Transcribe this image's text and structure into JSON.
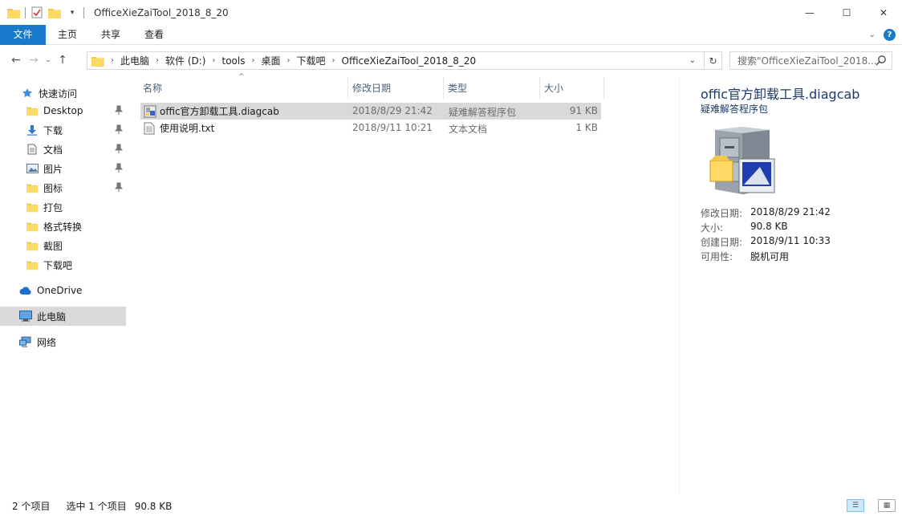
{
  "window": {
    "title": "OfficeXieZaiTool_2018_8_20",
    "minimize": "—",
    "maximize": "☐",
    "close": "✕"
  },
  "ribbon": {
    "tabs": [
      "文件",
      "主页",
      "共享",
      "查看"
    ]
  },
  "address": {
    "crumbs": [
      "此电脑",
      "软件 (D:)",
      "tools",
      "桌面",
      "下载吧",
      "OfficeXieZaiTool_2018_8_20"
    ]
  },
  "search": {
    "placeholder": "搜索\"OfficeXieZaiTool_2018..."
  },
  "sidebar": {
    "quick_access": "快速访问",
    "items": [
      {
        "label": "Desktop",
        "pinned": true
      },
      {
        "label": "下载",
        "pinned": true
      },
      {
        "label": "文档",
        "pinned": true
      },
      {
        "label": "图片",
        "pinned": true
      },
      {
        "label": "图标",
        "pinned": true
      },
      {
        "label": "打包",
        "pinned": false
      },
      {
        "label": "格式转换",
        "pinned": false
      },
      {
        "label": "截图",
        "pinned": false
      },
      {
        "label": "下载吧",
        "pinned": false
      }
    ],
    "onedrive": "OneDrive",
    "this_pc": "此电脑",
    "network": "网络"
  },
  "columns": {
    "name": "名称",
    "modified": "修改日期",
    "type": "类型",
    "size": "大小"
  },
  "files": [
    {
      "name": "offic官方卸载工具.diagcab",
      "modified": "2018/8/29 21:42",
      "type": "疑难解答程序包",
      "size": "91 KB",
      "selected": true
    },
    {
      "name": "使用说明.txt",
      "modified": "2018/9/11 10:21",
      "type": "文本文档",
      "size": "1 KB",
      "selected": false
    }
  ],
  "preview": {
    "title": "offic官方卸载工具.diagcab",
    "type": "疑难解答程序包",
    "props": [
      {
        "key": "修改日期:",
        "value": "2018/8/29 21:42"
      },
      {
        "key": "大小:",
        "value": "90.8 KB"
      },
      {
        "key": "创建日期:",
        "value": "2018/9/11 10:33"
      },
      {
        "key": "可用性:",
        "value": "脱机可用"
      }
    ]
  },
  "status": {
    "count": "2 个项目",
    "selected": "选中 1 个项目",
    "size": "90.8 KB"
  },
  "colors": {
    "accent": "#1979ca",
    "selection": "#d9d9d9"
  }
}
